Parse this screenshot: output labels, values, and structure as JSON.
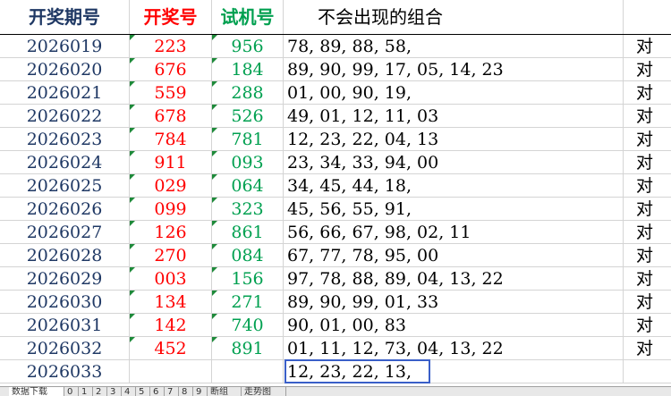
{
  "headers": {
    "period": "开奖期号",
    "draw": "开奖号",
    "test": "试机号",
    "combo": "不会出现的组合"
  },
  "rows": [
    {
      "period": "2026019",
      "draw": "223",
      "test": "956",
      "combo": "78, 89, 88, 58,",
      "mark": "对"
    },
    {
      "period": "2026020",
      "draw": "676",
      "test": "184",
      "combo": "89, 90, 99, 17, 05, 14, 23",
      "mark": "对"
    },
    {
      "period": "2026021",
      "draw": "559",
      "test": "288",
      "combo": "01, 00, 90, 19,",
      "mark": "对"
    },
    {
      "period": "2026022",
      "draw": "678",
      "test": "526",
      "combo": "49, 01, 12, 11, 03",
      "mark": "对"
    },
    {
      "period": "2026023",
      "draw": "784",
      "test": "781",
      "combo": "12, 23, 22, 04, 13",
      "mark": "对"
    },
    {
      "period": "2026024",
      "draw": "911",
      "test": "093",
      "combo": "23, 34, 33, 94, 00",
      "mark": "对"
    },
    {
      "period": "2026025",
      "draw": "029",
      "test": "064",
      "combo": "34, 45, 44, 18,",
      "mark": "对"
    },
    {
      "period": "2026026",
      "draw": "099",
      "test": "323",
      "combo": "45, 56, 55, 91,",
      "mark": "对"
    },
    {
      "period": "2026027",
      "draw": "126",
      "test": "861",
      "combo": "56, 66, 67, 98, 02, 11",
      "mark": "对"
    },
    {
      "period": "2026028",
      "draw": "270",
      "test": "084",
      "combo": "67, 77, 78, 95, 00",
      "mark": "对"
    },
    {
      "period": "2026029",
      "draw": "003",
      "test": "156",
      "combo": "97, 78, 88, 89, 04, 13, 22",
      "mark": "对"
    },
    {
      "period": "2026030",
      "draw": "134",
      "test": "271",
      "combo": "89, 90, 99, 01, 33",
      "mark": "对"
    },
    {
      "period": "2026031",
      "draw": "142",
      "test": "740",
      "combo": "90, 01, 00, 83",
      "mark": "对"
    },
    {
      "period": "2026032",
      "draw": "452",
      "test": "891",
      "combo": "01, 11, 12, 73, 04, 13, 22",
      "mark": "对"
    },
    {
      "period": "2026033",
      "draw": "",
      "test": "",
      "combo": "12, 23, 22, 13,",
      "mark": ""
    }
  ],
  "sheet_tabs": [
    "数据下载",
    "0",
    "1",
    "2",
    "3",
    "4",
    "5",
    "6",
    "7",
    "8",
    "9",
    "断组",
    "走势图"
  ],
  "colors": {
    "period": "#1f3864",
    "draw": "#ff0000",
    "test": "#00a050",
    "highlight_border": "#3a5fc8"
  }
}
